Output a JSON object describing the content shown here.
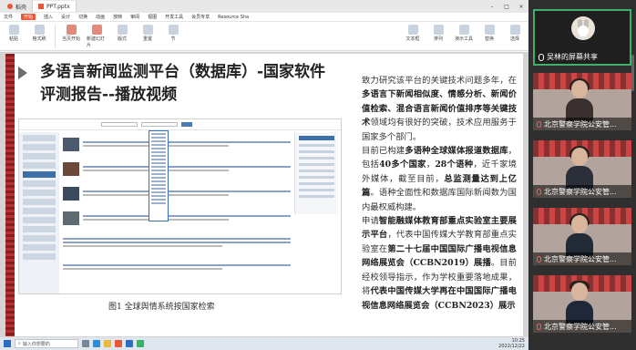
{
  "tabs": [
    {
      "label": "稻壳"
    },
    {
      "label": "PPT.pptx"
    }
  ],
  "menu": [
    "文件",
    "开始",
    "插入",
    "设计",
    "切换",
    "动画",
    "放映",
    "审阅",
    "视图",
    "开发工具",
    "会员专享",
    "Resource Sha"
  ],
  "active_menu": "开始",
  "ribbon": [
    "粘贴",
    "格式刷",
    "当页开始",
    "新建幻灯片",
    "版式",
    "重置",
    "节",
    "文本框",
    "排列",
    "演示工具",
    "替换",
    "选择"
  ],
  "slide": {
    "title": "多语言新闻监测平台（数据库）-国家软件评测报告--播放视频",
    "caption": "图1 全球舆情系统按国家检索",
    "paragraphs": [
      [
        {
          "t": "致力研究该平台的关键技术问题多年，在",
          "b": false
        },
        {
          "t": "多语言下新闻相似度、情感分析、新闻价值检索、混合语言新闻价值排序等关键技术",
          "b": true
        },
        {
          "t": "领域均有很好的突破，技术应用服务于国家多个部门。",
          "b": false
        }
      ],
      [
        {
          "t": "目前已构建",
          "b": false
        },
        {
          "t": "多语种全球媒体报道数据库",
          "b": true
        },
        {
          "t": "，包括",
          "b": false
        },
        {
          "t": "40多个国家",
          "b": true
        },
        {
          "t": "，",
          "b": false
        },
        {
          "t": "28个语种",
          "b": true
        },
        {
          "t": "，近千家境外媒体，截至目前，",
          "b": false
        },
        {
          "t": "总监测量达到上亿篇",
          "b": true
        },
        {
          "t": "。语种全面性和数据库国际新闻数为国内最权威构建。",
          "b": false
        }
      ],
      [
        {
          "t": "申请",
          "b": false
        },
        {
          "t": "智能融媒体教育部重点实验室主要展示平台",
          "b": true
        },
        {
          "t": "，代表中国传媒大学教育部重点实验室在",
          "b": false
        },
        {
          "t": "第二十七届中国国际广播电视信息网络展览会（CCBN2019）展播",
          "b": true
        },
        {
          "t": "。目前经校领导指示，作为学校重要落地成果，将",
          "b": false
        },
        {
          "t": "代表中国传媒大学再在中国国际广播电视信息网络展览会（CCBN2023）展示",
          "b": true
        }
      ]
    ]
  },
  "taskbar": {
    "search_placeholder": "输入你想要的",
    "time": "10:25",
    "date": "2022/12/22"
  },
  "meeting": {
    "my_screen_label": "吴林的屏幕共享",
    "participants": [
      {
        "name": "北京警察学院公安管..."
      },
      {
        "name": "北京警察学院公安管..."
      },
      {
        "name": "北京警察学院公安管..."
      },
      {
        "name": "北京警察学院公安管..."
      }
    ]
  },
  "colors": {
    "accent_red": "#e8573a",
    "stripe": "#8a1d1d",
    "share_border": "#3fb06a"
  }
}
